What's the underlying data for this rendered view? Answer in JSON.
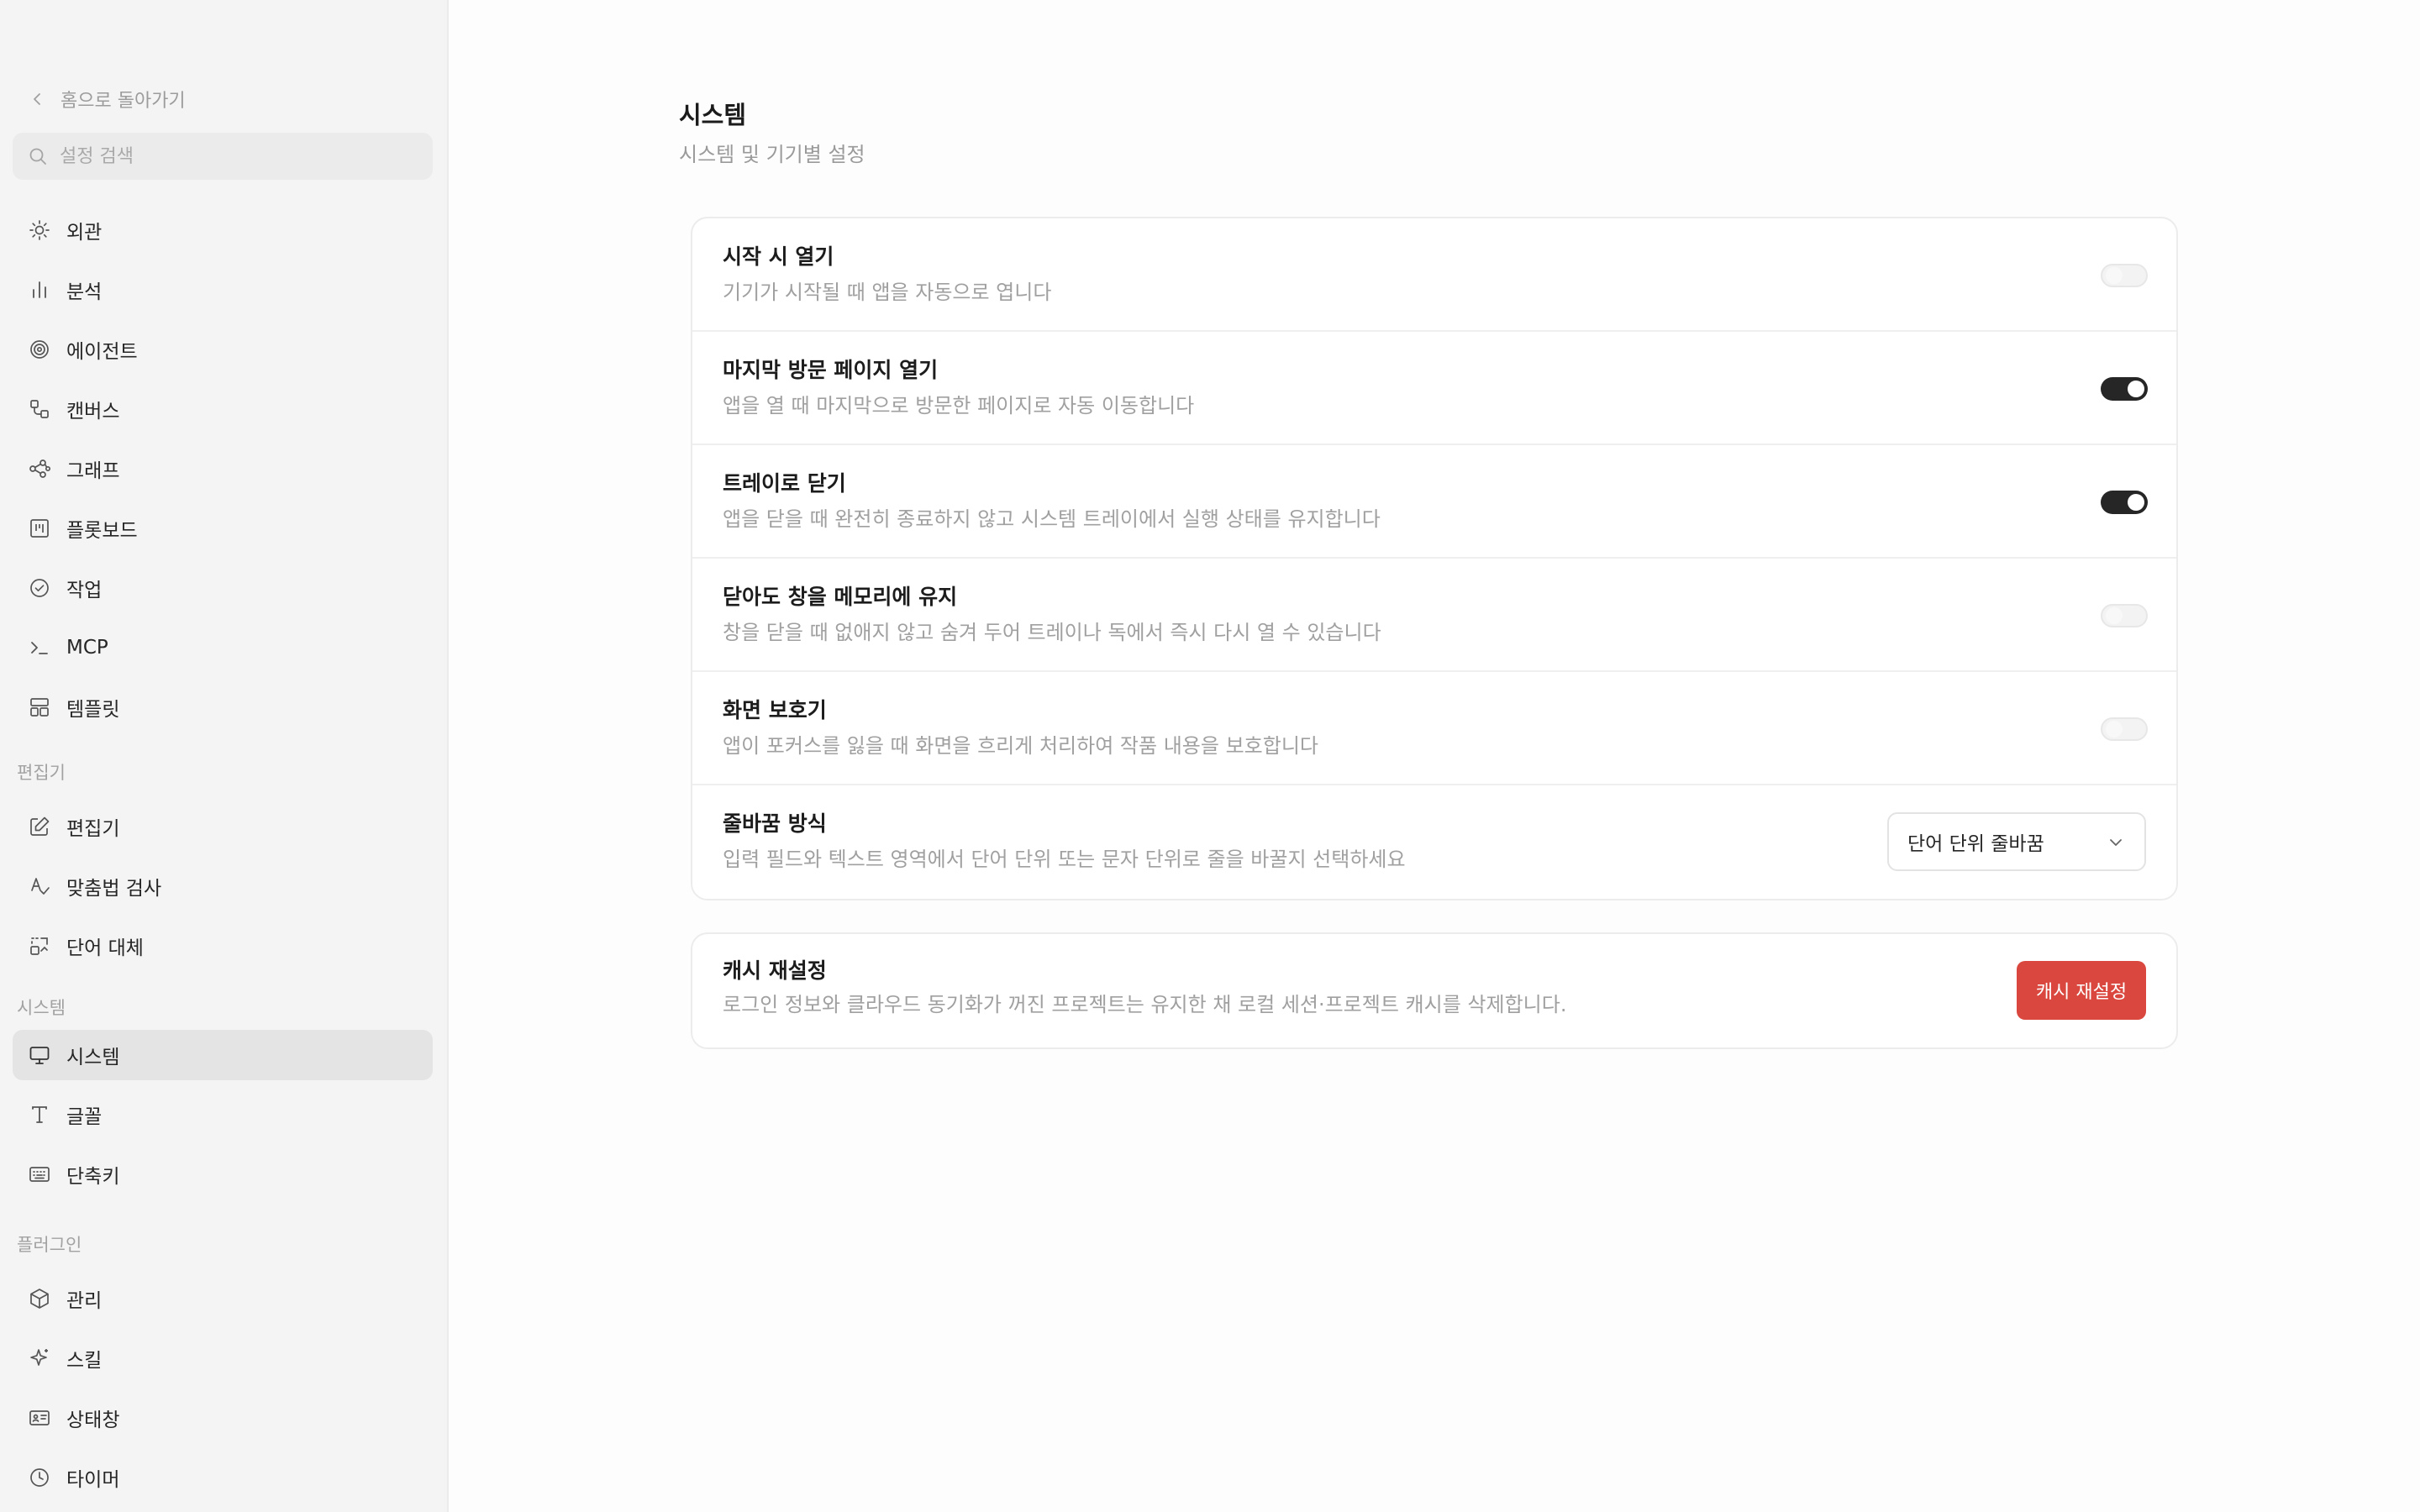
{
  "sidebar": {
    "back_label": "홈으로 돌아가기",
    "search_placeholder": "설정 검색",
    "items": [
      {
        "label": "외관",
        "icon": "sun-icon"
      },
      {
        "label": "분석",
        "icon": "bar-chart-icon"
      },
      {
        "label": "에이전트",
        "icon": "spiral-icon"
      },
      {
        "label": "캔버스",
        "icon": "canvas-icon"
      },
      {
        "label": "그래프",
        "icon": "graph-icon"
      },
      {
        "label": "플롯보드",
        "icon": "kanban-icon"
      },
      {
        "label": "작업",
        "icon": "check-circle-icon"
      },
      {
        "label": "MCP",
        "icon": "terminal-icon"
      },
      {
        "label": "템플릿",
        "icon": "layout-template-icon"
      }
    ],
    "groups": [
      {
        "header": "편집기",
        "items": [
          {
            "label": "편집기",
            "icon": "edit-icon"
          },
          {
            "label": "맞춤법 검사",
            "icon": "spellcheck-icon"
          },
          {
            "label": "단어 대체",
            "icon": "replace-icon"
          }
        ]
      },
      {
        "header": "시스템",
        "items": [
          {
            "label": "시스템",
            "icon": "monitor-icon",
            "active": true
          },
          {
            "label": "글꼴",
            "icon": "type-icon"
          },
          {
            "label": "단축키",
            "icon": "keyboard-icon"
          }
        ]
      },
      {
        "header": "플러그인",
        "items": [
          {
            "label": "관리",
            "icon": "package-icon"
          },
          {
            "label": "스킬",
            "icon": "sparkle-icon"
          },
          {
            "label": "상태창",
            "icon": "id-card-icon"
          },
          {
            "label": "타이머",
            "icon": "clock-icon"
          }
        ]
      }
    ]
  },
  "main": {
    "title": "시스템",
    "subtitle": "시스템 및 기기별 설정",
    "settings": [
      {
        "title": "시작 시 열기",
        "desc": "기기가 시작될 때 앱을 자동으로 엽니다",
        "toggle": "off"
      },
      {
        "title": "마지막 방문 페이지 열기",
        "desc": "앱을 열 때 마지막으로 방문한 페이지로 자동 이동합니다",
        "toggle": "on"
      },
      {
        "title": "트레이로 닫기",
        "desc": "앱을 닫을 때 완전히 종료하지 않고 시스템 트레이에서 실행 상태를 유지합니다",
        "toggle": "on"
      },
      {
        "title": "닫아도 창을 메모리에 유지",
        "desc": "창을 닫을 때 없애지 않고 숨겨 두어 트레이나 독에서 즉시 다시 열 수 있습니다",
        "toggle": "off"
      },
      {
        "title": "화면 보호기",
        "desc": "앱이 포커스를 잃을 때 화면을 흐리게 처리하여 작품 내용을 보호합니다",
        "toggle": "off"
      },
      {
        "title": "줄바꿈 방식",
        "desc": "입력 필드와 텍스트 영역에서 단어 단위 또는 문자 단위로 줄을 바꿀지 선택하세요",
        "select_value": "단어 단위 줄바꿈"
      }
    ],
    "cache": {
      "title": "캐시 재설정",
      "desc": "로그인 정보와 클라우드 동기화가 꺼진 프로젝트는 유지한 채 로컬 세션·프로젝트 캐시를 삭제합니다.",
      "button_label": "캐시 재설정"
    }
  },
  "colors": {
    "danger": "#d9473e",
    "toggle_on": "#262626",
    "sidebar_bg": "#f4f4f4"
  }
}
